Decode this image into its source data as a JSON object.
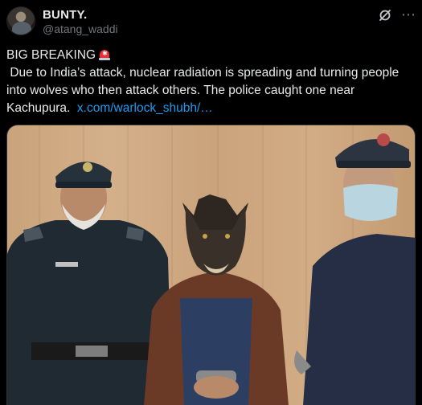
{
  "author": {
    "display_name": "BUNTY.",
    "handle": "@atang_waddi"
  },
  "tweet": {
    "headline": "BIG BREAKING",
    "body": "Due to India’s attack, nuclear radiation is spreading and turning people into wolves who then attack others. The police caught one near Kachupura.",
    "link_text": "x.com/warlock_shubh/…"
  },
  "icons": {
    "avatar": "profile-avatar",
    "grok": "grok-icon",
    "more": "more-options-icon",
    "siren": "siren-emoji"
  },
  "colors": {
    "background": "#000000",
    "text": "#e7e9ea",
    "muted": "#71767b",
    "link": "#1d9bf0"
  }
}
